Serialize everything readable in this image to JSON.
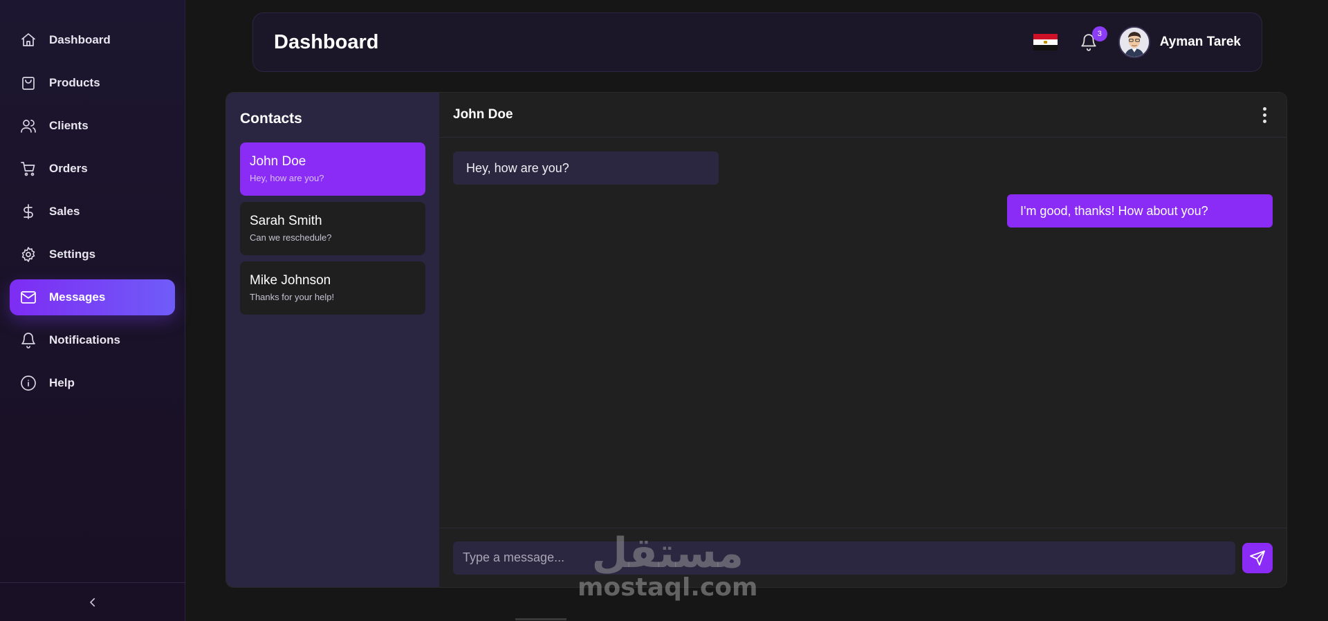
{
  "sidebar": {
    "items": [
      {
        "label": "Dashboard",
        "icon": "home-icon",
        "active": false
      },
      {
        "label": "Products",
        "icon": "shopping-bag-icon",
        "active": false
      },
      {
        "label": "Clients",
        "icon": "users-icon",
        "active": false
      },
      {
        "label": "Orders",
        "icon": "cart-icon",
        "active": false
      },
      {
        "label": "Sales",
        "icon": "dollar-icon",
        "active": false
      },
      {
        "label": "Settings",
        "icon": "gear-icon",
        "active": false
      },
      {
        "label": "Messages",
        "icon": "mail-icon",
        "active": true
      },
      {
        "label": "Notifications",
        "icon": "bell-icon",
        "active": false
      },
      {
        "label": "Help",
        "icon": "info-icon",
        "active": false
      }
    ],
    "collapse_icon": "chevron-left-icon"
  },
  "header": {
    "title": "Dashboard",
    "flag_icon": "egypt-flag-icon",
    "notification_count": "3",
    "user_name": "Ayman Tarek"
  },
  "contacts": {
    "title": "Contacts",
    "list": [
      {
        "name": "John Doe",
        "preview": "Hey, how are you?",
        "active": true
      },
      {
        "name": "Sarah Smith",
        "preview": "Can we reschedule?",
        "active": false
      },
      {
        "name": "Mike Johnson",
        "preview": "Thanks for your help!",
        "active": false
      }
    ]
  },
  "chat": {
    "contact_name": "John Doe",
    "messages": [
      {
        "text": "Hey, how are you?",
        "direction": "incoming"
      },
      {
        "text": "I'm good, thanks! How about you?",
        "direction": "outgoing"
      }
    ],
    "input_placeholder": "Type a message...",
    "input_value": ""
  },
  "watermark": {
    "arabic": "مستقل",
    "latin": "mostaql.com"
  },
  "colors": {
    "accent": "#8a2cf5",
    "sidebar_bg": "#1d1630",
    "panel_bg": "#202020",
    "contacts_bg": "#2a2540",
    "bubble_in": "#2c2740"
  }
}
